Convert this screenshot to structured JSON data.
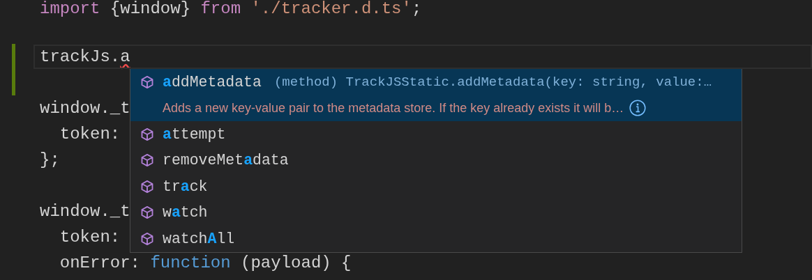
{
  "editor": {
    "lines": [
      {
        "tokens": [
          {
            "text": "import",
            "kind": "keyword"
          },
          {
            "text": " {window} ",
            "kind": "plain"
          },
          {
            "text": "from",
            "kind": "keyword"
          },
          {
            "text": " './tracker.d.ts'",
            "kind": "string"
          },
          {
            "text": ";",
            "kind": "plain"
          }
        ]
      },
      {
        "blank_before": true,
        "current": true,
        "modified": true,
        "tokens": [
          {
            "text": "trackJs.",
            "kind": "plain"
          },
          {
            "text": "a",
            "kind": "plain",
            "error": true
          }
        ]
      },
      {
        "modified": true
      },
      {
        "tokens": [
          {
            "text": "window._t",
            "kind": "plain"
          }
        ]
      },
      {
        "tokens": [
          {
            "text": "  token:",
            "kind": "plain"
          }
        ]
      },
      {
        "tokens": [
          {
            "text": "};",
            "kind": "plain"
          }
        ]
      },
      {
        "blank_before": true,
        "tokens": [
          {
            "text": "window._t",
            "kind": "plain"
          }
        ]
      },
      {
        "tokens": [
          {
            "text": "  token:",
            "kind": "plain"
          }
        ]
      },
      {
        "tokens": [
          {
            "text": "  onError: ",
            "kind": "plain"
          },
          {
            "text": "function",
            "kind": "function"
          },
          {
            "text": " (payload) {",
            "kind": "plain"
          }
        ]
      }
    ]
  },
  "suggestions": {
    "items": [
      {
        "selected": true,
        "parts": [
          {
            "text": "a",
            "match": true
          },
          {
            "text": "ddMetadata",
            "match": false
          }
        ],
        "detail": "(method) TrackJSStatic.addMetadata(key: string, value:…",
        "doc": "Adds a new key-value pair to the metadata store. If the key already exists it will b…"
      },
      {
        "selected": false,
        "parts": [
          {
            "text": "a",
            "match": true
          },
          {
            "text": "ttempt",
            "match": false
          }
        ]
      },
      {
        "selected": false,
        "parts": [
          {
            "text": "removeMet",
            "match": false
          },
          {
            "text": "a",
            "match": true
          },
          {
            "text": "data",
            "match": false
          }
        ]
      },
      {
        "selected": false,
        "parts": [
          {
            "text": "tr",
            "match": false
          },
          {
            "text": "a",
            "match": true
          },
          {
            "text": "ck",
            "match": false
          }
        ]
      },
      {
        "selected": false,
        "parts": [
          {
            "text": "w",
            "match": false
          },
          {
            "text": "a",
            "match": true
          },
          {
            "text": "tch",
            "match": false
          }
        ]
      },
      {
        "selected": false,
        "parts": [
          {
            "text": "watch",
            "match": false
          },
          {
            "text": "A",
            "match": true
          },
          {
            "text": "ll",
            "match": false
          }
        ]
      }
    ]
  }
}
